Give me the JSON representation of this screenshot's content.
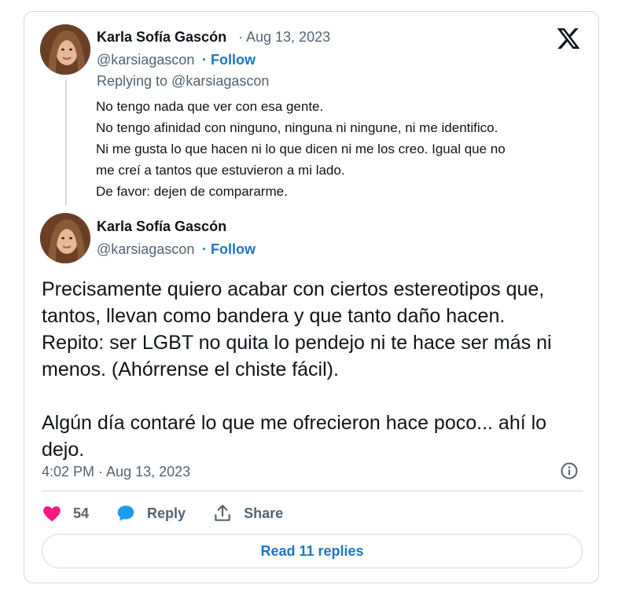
{
  "reply_tweet": {
    "author_name": "Karla Sofía Gascón",
    "date": "· Aug 13, 2023",
    "handle": "@karsiagascon",
    "follow_label": "· Follow",
    "replying_to": "Replying to @karsiagascon",
    "lines": [
      "No tengo nada que ver con esa gente.",
      "No tengo afinidad con ninguno, ninguna ni ningune, ni me identifico.",
      "Ni me gusta lo que hacen ni lo que dicen ni me los creo. Igual que no",
      "me creí a tantos que estuvieron a mi lado.",
      "De favor:  dejen de compararme."
    ]
  },
  "main_tweet": {
    "author_name": "Karla Sofía Gascón",
    "handle": "@karsiagascon",
    "follow_label": "· Follow",
    "lines": [
      "Precisamente quiero acabar con ciertos estereotipos que,",
      "tantos, llevan como bandera y que tanto daño hacen.",
      "Repito: ser LGBT no quita lo pendejo ni te hace ser más ni",
      "menos. (Ahórrense el chiste fácil).",
      "",
      "Algún día contaré lo que me ofrecieron hace poco... ahí lo",
      "dejo."
    ],
    "timestamp": "4:02 PM · Aug 13, 2023"
  },
  "actions": {
    "like_count": "54",
    "reply_label": "Reply",
    "share_label": "Share"
  },
  "read_replies_label": "Read 11 replies",
  "colors": {
    "like": "#f91880",
    "reply": "#1d9bf0",
    "link": "#1d76c4",
    "muted": "#536471",
    "border": "#cfd9de"
  },
  "icons": [
    "x-logo-icon",
    "info-icon",
    "heart-icon",
    "reply-bubble-icon",
    "share-icon"
  ]
}
